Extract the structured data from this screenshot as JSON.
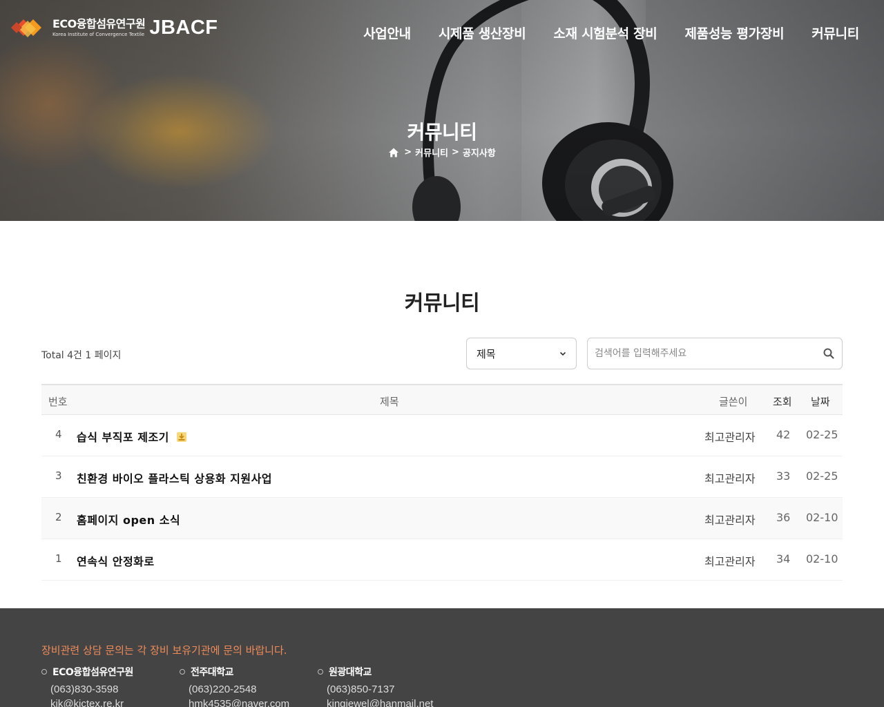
{
  "header": {
    "logo_kr": "ECO융합섬유연구원",
    "logo_en": "Korea Institute of Convergence Textile",
    "brand": "JBACF",
    "nav": [
      {
        "label": "사업안내"
      },
      {
        "label": "시제품 생산장비"
      },
      {
        "label": "소재 시험분석 장비"
      },
      {
        "label": "제품성능 평가장비"
      },
      {
        "label": "커뮤니티"
      }
    ]
  },
  "hero": {
    "title": "커뮤니티",
    "breadcrumb": [
      "커뮤니티",
      "공지사항"
    ],
    "separator": ">"
  },
  "main": {
    "title": "커뮤니티",
    "total": "Total 4건 1 페이지",
    "search": {
      "select_value": "제목",
      "placeholder": "검색어를 입력해주세요"
    },
    "columns": {
      "num": "번호",
      "subject": "제목",
      "writer": "글쓴이",
      "hit": "조회",
      "date": "날짜"
    },
    "rows": [
      {
        "num": "4",
        "subject": "습식 부직포 제조기",
        "writer": "최고관리자",
        "hit": "42",
        "date": "02-25",
        "has_file": true
      },
      {
        "num": "3",
        "subject": "친환경 바이오 플라스틱 상용화 지원사업",
        "writer": "최고관리자",
        "hit": "33",
        "date": "02-25",
        "has_file": false
      },
      {
        "num": "2",
        "subject": "홈페이지 open 소식",
        "writer": "최고관리자",
        "hit": "36",
        "date": "02-10",
        "has_file": false
      },
      {
        "num": "1",
        "subject": "연속식 안정화로",
        "writer": "최고관리자",
        "hit": "34",
        "date": "02-10",
        "has_file": false
      }
    ]
  },
  "footer": {
    "notice": "장비관련 상담 문의는 각 장비 보유기관에 문의 바랍니다.",
    "contacts": [
      {
        "name": "ECO융합섬유연구원",
        "phone": "(063)830-3598",
        "email": "kik@kictex.re.kr"
      },
      {
        "name": "전주대학교",
        "phone": "(063)220-2548",
        "email": "hmk4535@naver.com"
      },
      {
        "name": "원광대학교",
        "phone": "(063)850-7137",
        "email": "kingjewel@hanmail.net"
      }
    ]
  },
  "colors": {
    "footer_bg": "#444444",
    "footer_notice": "#f08c5a",
    "logo_orange": "#f39a1f",
    "logo_red": "#e84e2c"
  },
  "icons": [
    "home-icon",
    "search-icon",
    "chevron-down-icon",
    "file-download-icon"
  ]
}
